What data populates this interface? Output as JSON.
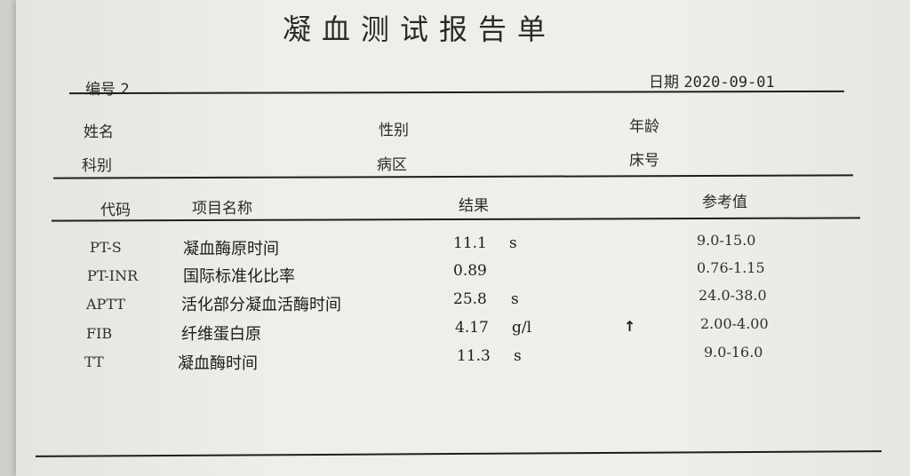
{
  "report": {
    "title": "凝血测试报告单",
    "number_label": "编号",
    "number_value": "2",
    "date_label": "日期",
    "date_value": "2020-09-01"
  },
  "patient": {
    "name_label": "姓名",
    "gender_label": "性别",
    "age_label": "年龄",
    "department_label": "科别",
    "ward_label": "病区",
    "bed_label": "床号"
  },
  "table": {
    "headers": {
      "code": "代码",
      "name": "项目名称",
      "result": "结果",
      "reference": "参考值"
    },
    "rows": [
      {
        "code": "PT-S",
        "name": "凝血酶原时间",
        "result": "11.1",
        "unit": "s",
        "flag": "",
        "reference": "9.0-15.0"
      },
      {
        "code": "PT-INR",
        "name": "国际标准化比率",
        "result": "0.89",
        "unit": "",
        "flag": "",
        "reference": "0.76-1.15"
      },
      {
        "code": "APTT",
        "name": "活化部分凝血活酶时间",
        "result": "25.8",
        "unit": "s",
        "flag": "",
        "reference": "24.0-38.0"
      },
      {
        "code": "FIB",
        "name": "纤维蛋白原",
        "result": "4.17",
        "unit": "g/l",
        "flag": "↑",
        "reference": "2.00-4.00"
      },
      {
        "code": "TT",
        "name": "凝血酶时间",
        "result": "11.3",
        "unit": "s",
        "flag": "",
        "reference": "9.0-16.0"
      }
    ]
  }
}
